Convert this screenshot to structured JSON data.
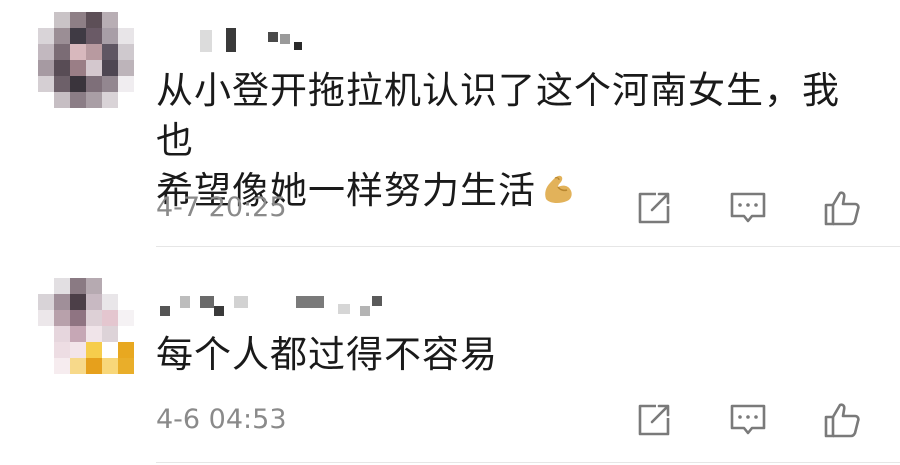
{
  "comments": [
    {
      "text_line1": "从小登开拖拉机认识了这个河南女生，我也",
      "text_line2": "希望像她一样努力生活",
      "emoji": "flexed-biceps-emoji",
      "time": "4-7 20:25",
      "actions": [
        "share-icon",
        "reply-icon",
        "like-icon"
      ]
    },
    {
      "text_line1": "每个人都过得不容易",
      "time": "4-6 04:53",
      "actions": [
        "share-icon",
        "reply-icon",
        "like-icon"
      ]
    }
  ],
  "colors": {
    "text": "#1a1a1a",
    "meta": "#8a8a8a",
    "icon": "#7a7a7a",
    "divider": "#e6e6e6"
  }
}
